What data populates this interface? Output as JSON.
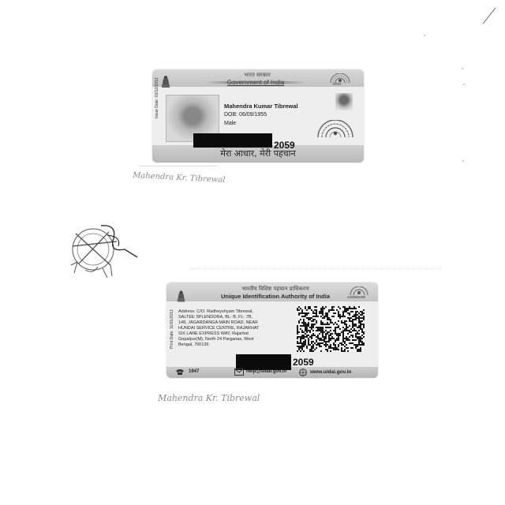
{
  "front_card": {
    "gov_hindi": "भारत सरकार",
    "gov_english": "Government of India",
    "issue_date": "Issue Date: 03/12/2012",
    "name": "Mahendra Kumar Tibrewal",
    "dob": "DOB: 06/09/1955",
    "gender": "Male",
    "number_visible": "2059",
    "tagline": "मेरा आधार, मेरी पहचान",
    "aadhaar_logo_text": "आधार"
  },
  "back_card": {
    "uidai_hindi": "भारतीय विशिष्ट पहचान प्राधिकरण",
    "uidai_english": "Unique Identification Authority of India",
    "aadhaar_logo_text": "AADHAAR",
    "print_date": "Print Date: 11/01/2013",
    "address_lines": [
      "Address: C/O: Radheyshyam Tibrewal,",
      "SALTEE SPLENDORA, BL- B, FL- 7B,",
      "148, JAGARDANGA MAIN ROAD, NEAR",
      "HUNDAI SERVICE CENTRE, RAJARHAT",
      "SIX LANE EXPRESS WAY, Rajarhat",
      "Gopalpur(M), North 24 Parganas, West",
      "Bengal, 700136"
    ],
    "number_visible": "2059",
    "helpline": "1947",
    "email": "help@uidai.gov.in",
    "website": "www.uidai.gov.in"
  },
  "annotations": {
    "handwriting_front": "Mahendra Kr. Tibrewal",
    "handwriting_back": "Mahendra Kr. Tibrewal"
  },
  "colors": {
    "paper": "#ffffff",
    "card_gray": "#eeeeee",
    "redaction": "#0b0b0b",
    "handwriting": "#8a8a8a"
  }
}
